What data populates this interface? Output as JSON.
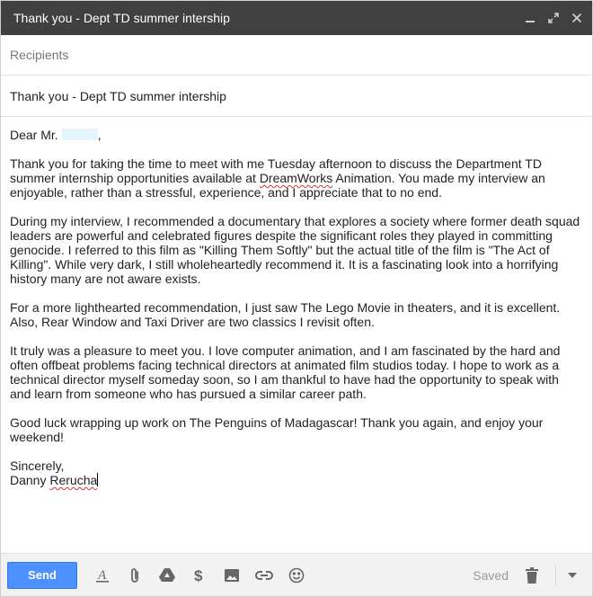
{
  "window": {
    "title": "Thank you - Dept TD summer intership"
  },
  "compose": {
    "recipients_placeholder": "Recipients",
    "subject": "Thank you - Dept TD summer intership",
    "greeting_prefix": "Dear Mr.",
    "greeting_suffix": ",",
    "p1_a": "Thank you for taking the time to meet with me Tuesday afternoon to discuss the Department TD summer internship opportunities available at ",
    "p1_company": "DreamWorks",
    "p1_b": " Animation. You made my interview an enjoyable, rather than a stressful, experience, and I appreciate that to no end.",
    "p2": "During my interview, I recommended a documentary that explores a society where former death squad leaders are powerful and celebrated figures despite the significant roles they played in committing genocide. I referred to this film as \"Killing Them Softly\" but the actual title of the film is \"The Act of Killing\". While very dark, I still wholeheartedly recommend it. It is a fascinating look into a horrifying history many are not aware exists.",
    "p3": "For a more lighthearted recommendation, I just saw The Lego Movie in theaters, and it is excellent. Also, Rear Window and Taxi Driver are two classics I revisit often.",
    "p4": "It truly was a pleasure to meet you. I love computer animation, and I am fascinated by the hard and often offbeat problems facing technical directors at animated film studios today. I hope to work as a technical director myself someday soon, so I am thankful to have had the opportunity to speak with and learn from someone who has pursued a similar career path.",
    "p5": "Good luck wrapping up work on The Penguins of Madagascar! Thank you again, and enjoy your weekend!",
    "closing": "Sincerely,",
    "signature_first": "Danny",
    "signature_last": "Rerucha"
  },
  "toolbar": {
    "send_label": "Send",
    "saved_label": "Saved",
    "icons": [
      "format-text-icon",
      "attach-icon",
      "drive-icon",
      "money-icon",
      "photo-icon",
      "link-icon",
      "emoji-icon",
      "trash-icon",
      "more-options-icon"
    ]
  },
  "colors": {
    "titlebar": "#404040",
    "send_button": "#4d90fe",
    "redaction": "#e3f6ff",
    "spellcheck": "#dd3333"
  }
}
